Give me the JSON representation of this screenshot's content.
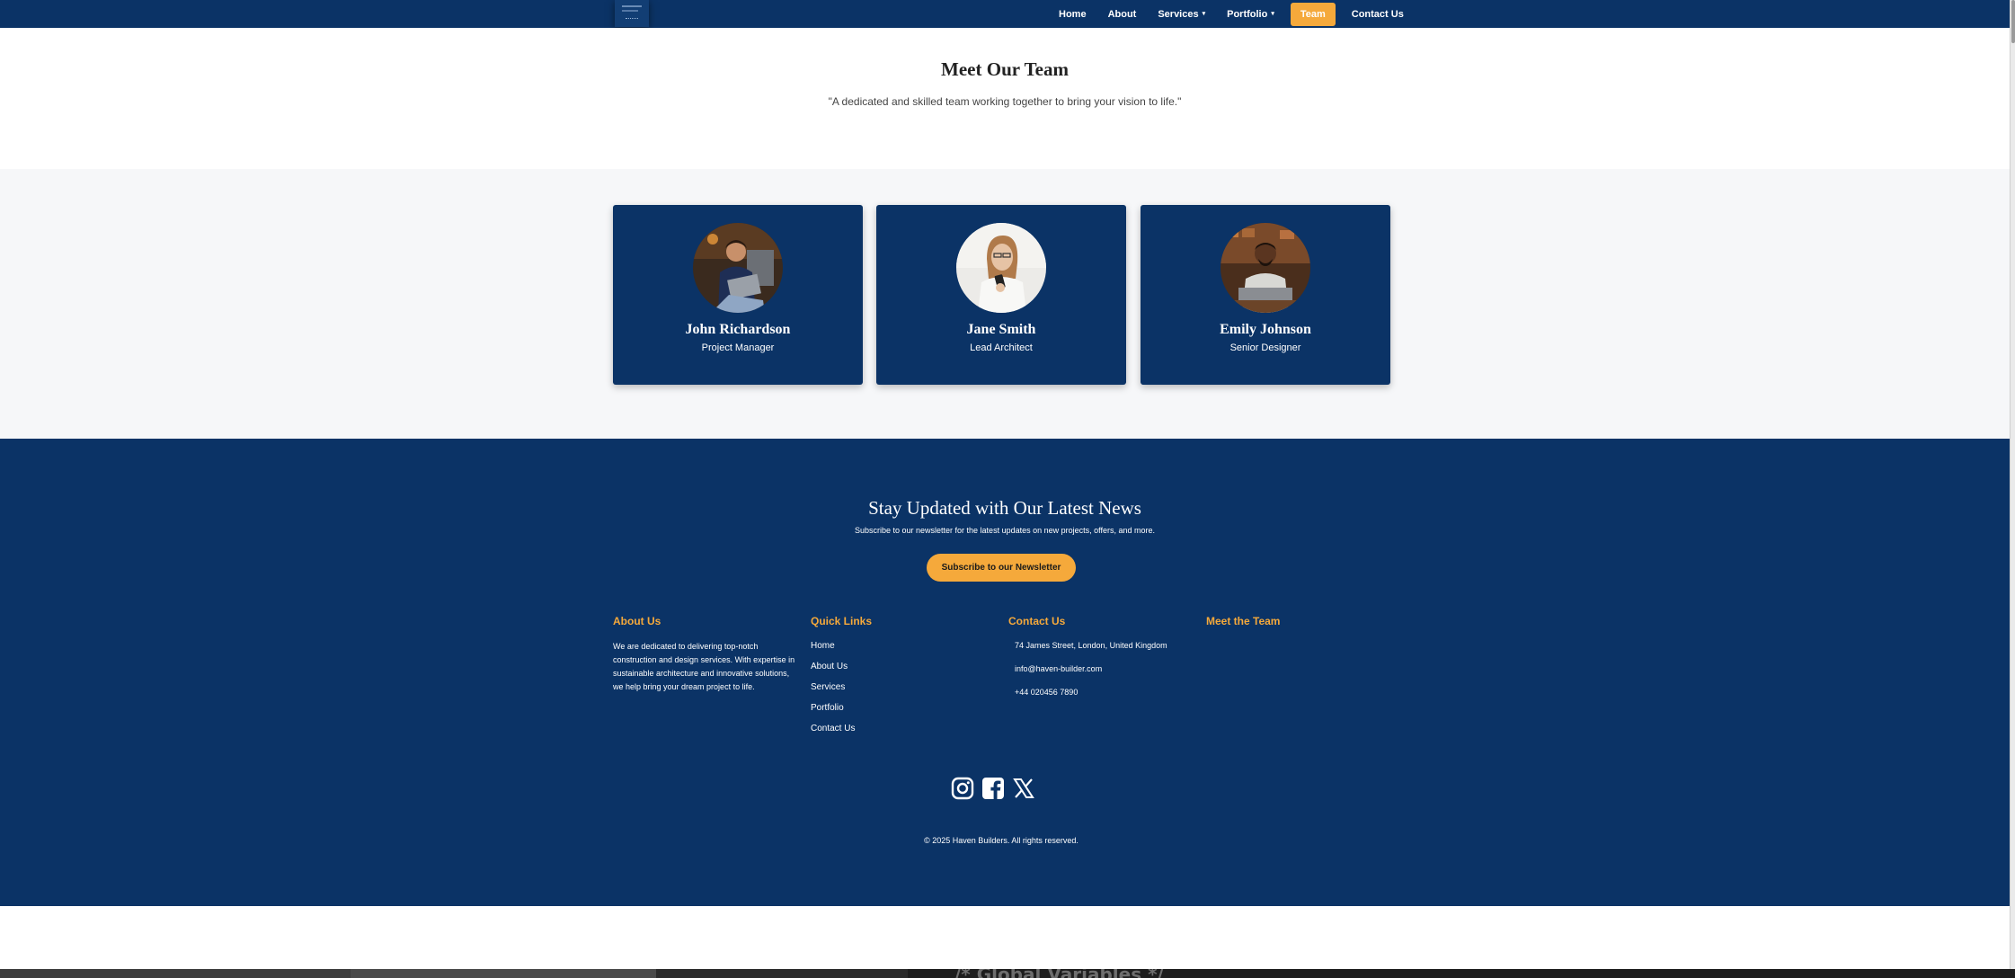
{
  "nav": {
    "items": [
      {
        "label": "Home"
      },
      {
        "label": "About"
      },
      {
        "label": "Services",
        "dropdown": true
      },
      {
        "label": "Portfolio",
        "dropdown": true
      },
      {
        "label": "Team",
        "active": true
      },
      {
        "label": "Contact Us"
      }
    ],
    "caret": "▾"
  },
  "hero": {
    "title": "Meet Our Team",
    "subtitle": "\"A dedicated and skilled team working together to bring your vision to life.\""
  },
  "team": [
    {
      "name": "John Richardson",
      "role": "Project Manager"
    },
    {
      "name": "Jane Smith",
      "role": "Lead Architect"
    },
    {
      "name": "Emily Johnson",
      "role": "Senior Designer"
    }
  ],
  "newsletter": {
    "title": "Stay Updated with Our Latest News",
    "subtitle": "Subscribe to our newsletter for the latest updates on new projects, offers, and more.",
    "button": "Subscribe to our Newsletter"
  },
  "footer": {
    "about": {
      "heading": "About Us",
      "text": "We are dedicated to delivering top-notch construction and design services. With expertise in sustainable architecture and innovative solutions, we help bring your dream project to life."
    },
    "quick_links": {
      "heading": "Quick Links",
      "links": [
        "Home",
        "About Us",
        "Services",
        "Portfolio",
        "Contact Us"
      ]
    },
    "contact": {
      "heading": "Contact Us",
      "address": "74 James Street, London, United Kingdom",
      "email": "info@haven-builder.com",
      "phone": "+44 020456 7890"
    },
    "team": {
      "heading": "Meet the Team"
    },
    "socials": [
      "instagram-icon",
      "facebook-icon",
      "x-icon"
    ],
    "copyright": "© 2025 Haven Builders. All rights reserved."
  },
  "editor_peek": {
    "text": "/* Global Variables */"
  },
  "colors": {
    "navy": "#0b3366",
    "accent": "#f5a93b",
    "light_bg": "#f6f7f9"
  }
}
